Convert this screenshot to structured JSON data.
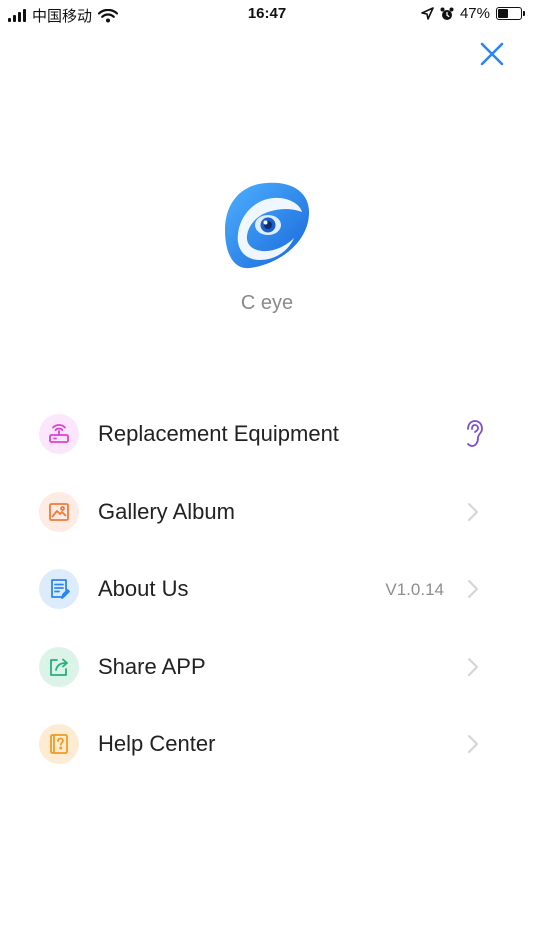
{
  "status_bar": {
    "carrier": "中国移动",
    "time": "16:47",
    "battery": "47%",
    "battery_level": 0.47
  },
  "app": {
    "name": "C eye",
    "logo_icon": "eye-logo-icon",
    "brand_color": "#2a86f0"
  },
  "menu": {
    "items": [
      {
        "label": "Replacement Equipment",
        "icon": "router-icon",
        "value": "",
        "trailing": "ear-icon"
      },
      {
        "label": "Gallery Album",
        "icon": "image-icon",
        "value": "",
        "trailing": "chevron-right-icon"
      },
      {
        "label": "About Us",
        "icon": "document-icon",
        "value": "V1.0.14",
        "trailing": "chevron-right-icon"
      },
      {
        "label": "Share APP",
        "icon": "share-icon",
        "value": "",
        "trailing": "chevron-right-icon"
      },
      {
        "label": "Help Center",
        "icon": "help-book-icon",
        "value": "",
        "trailing": "chevron-right-icon"
      }
    ]
  }
}
